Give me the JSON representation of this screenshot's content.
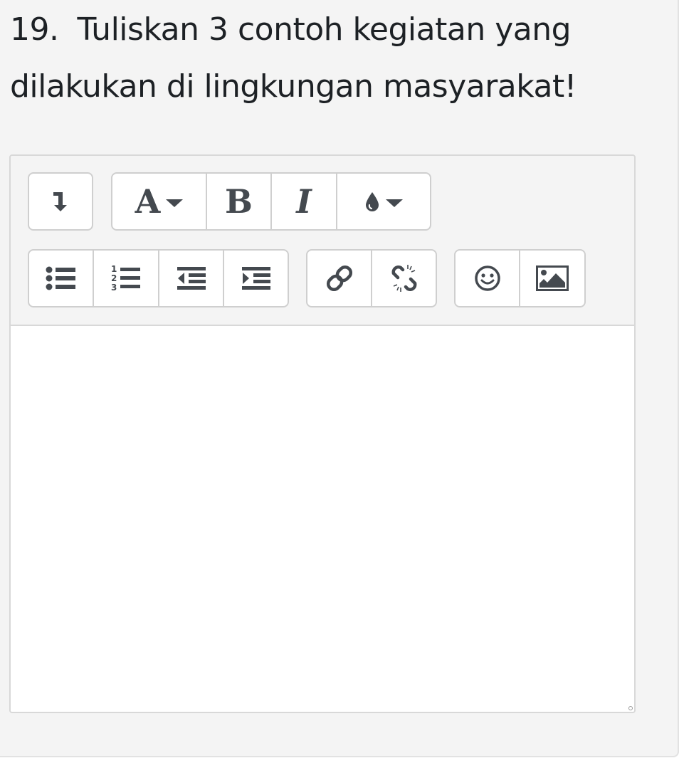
{
  "question": {
    "number": "19.",
    "text_line1": "Tuliskan 3 contoh kegiatan yang",
    "text_line2": "dilakukan di lingkungan masyarakat!"
  },
  "toolbar": {
    "row1": [
      {
        "name": "toolbar-toggle-button",
        "icon": "arrow-down-icon"
      },
      {
        "name": "font-size-button",
        "glyph": "A",
        "icon": "caret-down-icon"
      },
      {
        "name": "bold-button",
        "glyph": "B"
      },
      {
        "name": "italic-button",
        "glyph": "I"
      },
      {
        "name": "text-color-button",
        "icon": "droplet-icon"
      }
    ],
    "row2": [
      {
        "name": "unordered-list-button",
        "icon": "list-ul-icon"
      },
      {
        "name": "ordered-list-button",
        "icon": "list-ol-icon"
      },
      {
        "name": "outdent-button",
        "icon": "outdent-icon"
      },
      {
        "name": "indent-button",
        "icon": "indent-icon"
      },
      {
        "name": "link-button",
        "icon": "link-icon"
      },
      {
        "name": "unlink-button",
        "icon": "unlink-icon"
      },
      {
        "name": "emoji-button",
        "icon": "smile-icon"
      },
      {
        "name": "image-button",
        "icon": "image-icon"
      }
    ]
  },
  "editor": {
    "content": ""
  },
  "colors": {
    "icon": "#44494f",
    "border": "#cfcfcf",
    "background": "#f4f4f4",
    "text": "#1d2125"
  }
}
